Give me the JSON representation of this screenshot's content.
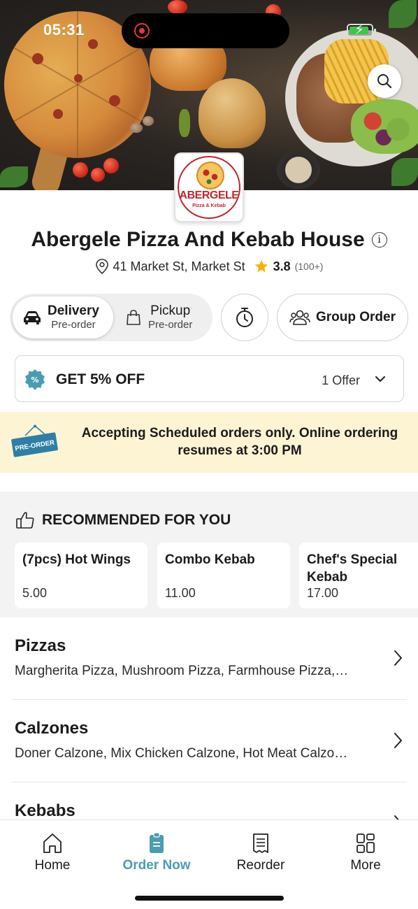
{
  "status_bar": {
    "time": "05:31",
    "battery_level": 0.9
  },
  "restaurant": {
    "name": "Abergele Pizza And Kebab House",
    "address": "41 Market St, Market St",
    "rating": "3.8",
    "reviews": "(100+)",
    "logo_text": "ABERGELE",
    "logo_subtext": "Pizza & Kebab"
  },
  "order_mode": {
    "delivery": {
      "label": "Delivery",
      "sub": "Pre-order",
      "selected": true
    },
    "pickup": {
      "label": "Pickup",
      "sub": "Pre-order",
      "selected": false
    },
    "group_order_label": "Group Order"
  },
  "offer": {
    "title": "GET 5% OFF",
    "count": "1 Offer"
  },
  "banner": {
    "sign_text": "PRE-ORDER",
    "message": "Accepting Scheduled orders only. Online ordering resumes at 3:00 PM"
  },
  "recommended": {
    "title": "RECOMMENDED FOR YOU",
    "items": [
      {
        "name": "(7pcs) Hot Wings",
        "price": "5.00"
      },
      {
        "name": "Combo Kebab",
        "price": "11.00"
      },
      {
        "name": "Chef's Special Kebab",
        "price": "17.00"
      }
    ]
  },
  "categories": [
    {
      "name": "Pizzas",
      "items": "Margherita Pizza, Mushroom Pizza, Farmhouse Pizza,…"
    },
    {
      "name": "Calzones",
      "items": "Doner Calzone, Mix Chicken Calzone, Hot Meat Calzo…"
    },
    {
      "name": "Kebabs",
      "items": ""
    }
  ],
  "tabs": [
    {
      "label": "Home",
      "icon": "home-icon"
    },
    {
      "label": "Order Now",
      "icon": "order-icon",
      "active": true
    },
    {
      "label": "Reorder",
      "icon": "receipt-icon"
    },
    {
      "label": "More",
      "icon": "grid-icon"
    }
  ],
  "colors": {
    "accent": "#4a9db0",
    "star": "#f5b301",
    "banner_bg": "#fdf4d4",
    "logo_red": "#c2272d"
  }
}
